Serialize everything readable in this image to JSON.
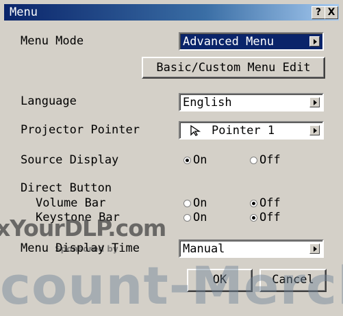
{
  "window": {
    "title": "Menu",
    "help_glyph": "?",
    "close_glyph": "X"
  },
  "menu_mode": {
    "label": "Menu Mode",
    "value": "Advanced Menu",
    "edit_button": "Basic/Custom Menu Edit"
  },
  "language": {
    "label": "Language",
    "value": "English"
  },
  "projector_pointer": {
    "label": "Projector Pointer",
    "value": "Pointer 1",
    "icon": "pointer-arrow-icon"
  },
  "source_display": {
    "label": "Source Display",
    "on_label": "On",
    "off_label": "Off",
    "selected": "On"
  },
  "direct_button": {
    "label": "Direct Button",
    "volume_bar": {
      "label": "Volume Bar",
      "on_label": "On",
      "off_label": "Off",
      "selected": "Off"
    },
    "keystone_bar": {
      "label": "Keystone Bar",
      "on_label": "On",
      "off_label": "Off",
      "selected": "Off"
    }
  },
  "menu_display_time": {
    "label": "Menu Display Time",
    "value": "Manual"
  },
  "buttons": {
    "ok": "OK",
    "cancel": "Cancel"
  },
  "watermark": {
    "site": "xYourDLP.com",
    "sponsor": "Sponsored by",
    "banner": "count-Mercha"
  },
  "colors": {
    "title_bar": "#0a246a",
    "face": "#d4d0c8",
    "selected_field": "#0a246a"
  }
}
